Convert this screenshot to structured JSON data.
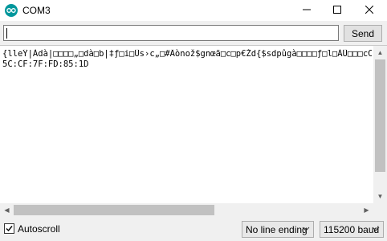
{
  "window": {
    "title": "COM3"
  },
  "send_row": {
    "input_value": "",
    "send_label": "Send"
  },
  "output": {
    "lines": [
      "{lleŸ|Àdà|□□□□„□dà□b|‡ƒ□i□Üs›c„□#Äònož$gnœã□c□p€Žd{$sdpûgà□□□□ƒ□l□ÀÛ□□□cC",
      "5C:CF:7F:FD:85:1D"
    ]
  },
  "bottom_bar": {
    "autoscroll_label": "Autoscroll",
    "autoscroll_checked": true,
    "line_ending": "No line ending",
    "baud_rate": "115200 baud"
  },
  "icons": {
    "app": "arduino-icon",
    "minimize": "minimize-icon",
    "maximize": "maximize-icon",
    "close": "close-icon",
    "dropdown": "chevron-down-icon",
    "check": "check-icon"
  },
  "colors": {
    "app_icon": "#00979c",
    "chrome": "#f0f0f0",
    "scroll_thumb": "#c1c1c1"
  }
}
